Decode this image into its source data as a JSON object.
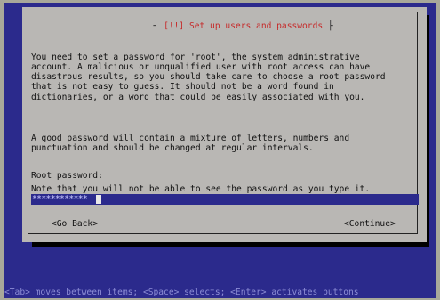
{
  "dialog": {
    "title": "[!!] Set up users and passwords",
    "paragraphs": [
      "You need to set a password for 'root', the system administrative\naccount. A malicious or unqualified user with root access can have\ndisastrous results, so you should take care to choose a root password\nthat is not easy to guess. It should not be a word found in\ndictionaries, or a word that could be easily associated with you.",
      "A good password will contain a mixture of letters, numbers and\npunctuation and should be changed at regular intervals.",
      "Note that you will not be able to see the password as you type it."
    ],
    "password_label": "Root password:",
    "password_mask": "************",
    "buttons": {
      "back": "<Go Back>",
      "continue": "<Continue>"
    }
  },
  "footer": {
    "help_text": "<Tab> moves between items; <Space> selects; <Enter> activates buttons"
  },
  "colors": {
    "background": "#2b2a8c",
    "dialog": "#b9b7b4",
    "title_text": "#c62a2a",
    "field": "#2b2a8c"
  }
}
